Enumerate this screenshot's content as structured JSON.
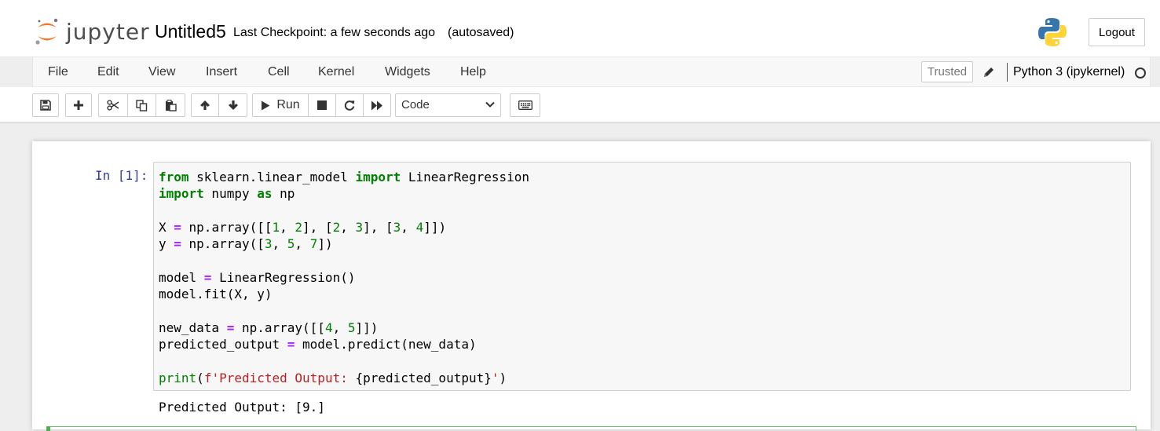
{
  "header": {
    "logo_text": "jupyter",
    "notebook_name": "Untitled5",
    "checkpoint": "Last Checkpoint: a few seconds ago",
    "autosave": "(autosaved)",
    "logout_label": "Logout"
  },
  "menubar": {
    "items": [
      "File",
      "Edit",
      "View",
      "Insert",
      "Cell",
      "Kernel",
      "Widgets",
      "Help"
    ],
    "trusted_label": "Trusted",
    "kernel_name": "Python 3 (ipykernel)"
  },
  "toolbar": {
    "buttons": [
      {
        "name": "save",
        "icon": "floppy-icon"
      },
      {
        "name": "insert-cell",
        "icon": "plus-icon"
      },
      {
        "name": "cut",
        "icon": "scissors-icon"
      },
      {
        "name": "copy",
        "icon": "copy-icon"
      },
      {
        "name": "paste",
        "icon": "paste-icon"
      },
      {
        "name": "move-up",
        "icon": "arrow-up-icon"
      },
      {
        "name": "move-down",
        "icon": "arrow-down-icon"
      },
      {
        "name": "run",
        "icon": "play-icon"
      },
      {
        "name": "interrupt",
        "icon": "stop-icon"
      },
      {
        "name": "restart",
        "icon": "restart-icon"
      },
      {
        "name": "restart-run-all",
        "icon": "fast-forward-icon"
      },
      {
        "name": "command-palette",
        "icon": "keyboard-icon"
      }
    ],
    "run_label": "Run",
    "cell_type": "Code"
  },
  "cell": {
    "prompt": "In [1]:",
    "code_lines": [
      "from sklearn.linear_model import LinearRegression",
      "import numpy as np",
      "",
      "X = np.array([[1, 2], [2, 3], [3, 4]])",
      "y = np.array([3, 5, 7])",
      "",
      "model = LinearRegression()",
      "model.fit(X, y)",
      "",
      "new_data = np.array([[4, 5]])",
      "predicted_output = model.predict(new_data)",
      "",
      "print(f'Predicted Output: {predicted_output}')"
    ],
    "output": "Predicted Output: [9.]"
  },
  "colors": {
    "prompt_in": "#303f9f",
    "keyword": "#008000",
    "operator": "#aa22ff",
    "string": "#ba2121",
    "logo_orange": "#f37726",
    "python_blue": "#3776ab",
    "python_yellow": "#ffd43b"
  }
}
